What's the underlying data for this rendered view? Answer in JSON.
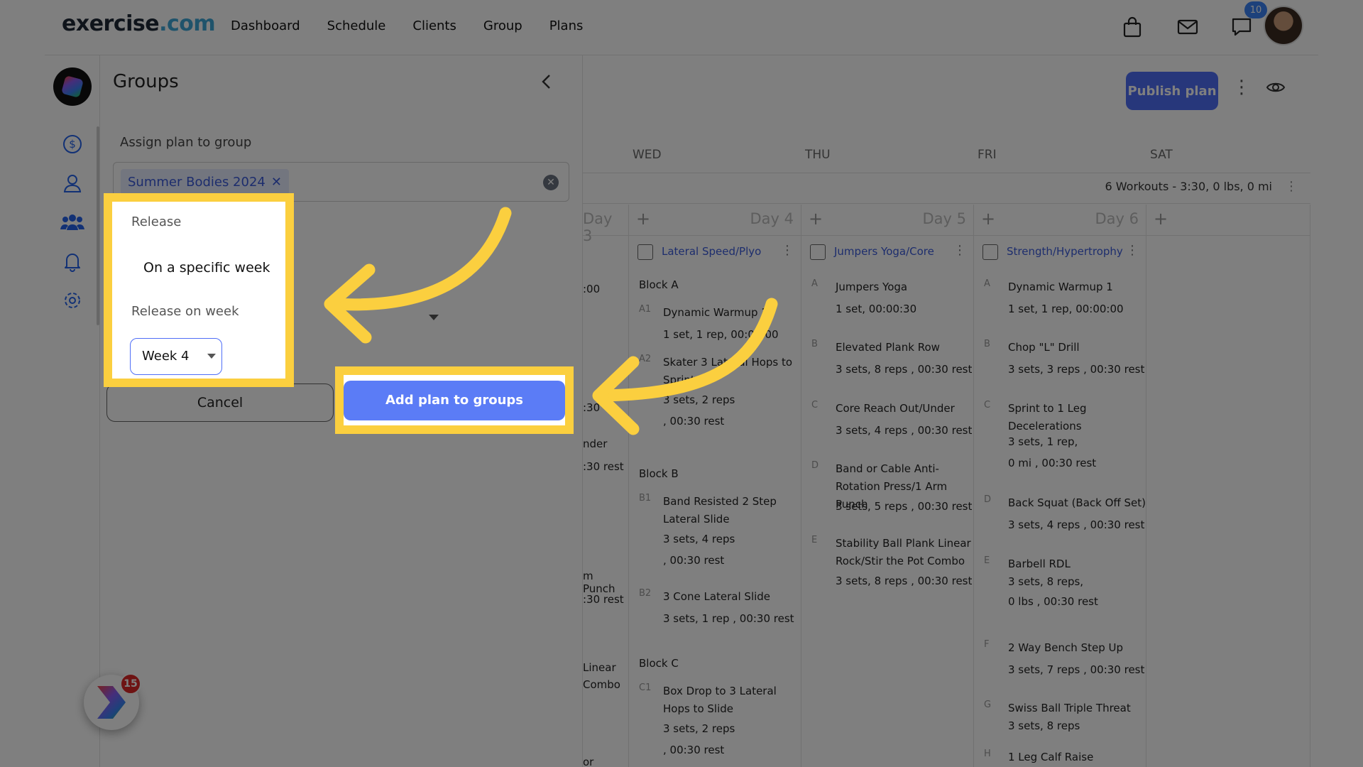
{
  "topbar": {
    "logo_main": "exercise",
    "logo_dom": ".com",
    "nav": [
      "Dashboard",
      "Schedule",
      "Clients",
      "Group",
      "Plans"
    ],
    "notification_count": "10"
  },
  "widget": {
    "badge": "15"
  },
  "panel": {
    "title": "Groups",
    "assign_label": "Assign plan to group",
    "chip_label": "Summer Bodies 2024",
    "release_label": "Release",
    "release_value": "On a specific week",
    "week_label": "Release on week",
    "week_value": "Week 4",
    "cancel_label": "Cancel",
    "add_label": "Add plan to groups"
  },
  "calendar": {
    "publish_label": "Publish plan",
    "day_headers": [
      "WED",
      "THU",
      "FRI",
      "SAT"
    ],
    "summary": "6 Workouts - 3:30, 0 lbs, 0 mi",
    "columns": [
      {
        "day": "Day 3",
        "title": "",
        "partial": true
      },
      {
        "day": "Day 4",
        "title": "Lateral Speed/Plyo"
      },
      {
        "day": "Day 5",
        "title": "Jumpers Yoga/Core"
      },
      {
        "day": "Day 6",
        "title": "Strength/Hypertrophy"
      },
      {
        "day": "",
        "title": ""
      }
    ],
    "partial_texts": [
      ":00",
      ":30",
      "nder",
      ":30 rest",
      "m Punch",
      ":30 rest",
      "Linear",
      "Combo",
      "or"
    ],
    "day4": {
      "blockA": "Block A",
      "a1_code": "A1",
      "a1_name": "Dynamic Warmup 1",
      "a1_d1": "1 set, 1 rep, 00:00:00",
      "a2_code": "A2",
      "a2_name": "Skater 3 Lateral Hops to Sprint",
      "a2_d1": "3 sets, 2 reps",
      "a2_d2": ", 00:30 rest",
      "blockB": "Block B",
      "b1_code": "B1",
      "b1_name": "Band Resisted 2 Step Lateral Slide",
      "b1_d1": "3 sets, 4 reps",
      "b1_d2": ", 00:30 rest",
      "b2_code": "B2",
      "b2_name": "3 Cone Lateral Slide",
      "b2_d1": "3 sets, 1 rep , 00:30 rest",
      "blockC": "Block C",
      "c1_code": "C1",
      "c1_name": "Box Drop to 3 Lateral Hops to Slide",
      "c1_d1": "3 sets, 2 reps",
      "c1_d2": ", 00:30 rest"
    },
    "day5": {
      "a_code": "A",
      "a_name": "Jumpers Yoga",
      "a_d1": "1 set, 00:00:30",
      "b_code": "B",
      "b_name": "Elevated Plank Row",
      "b_d1": "3 sets, 8 reps , 00:30 rest",
      "c_code": "C",
      "c_name": "Core Reach Out/Under",
      "c_d1": "3 sets, 4 reps , 00:30 rest",
      "d_code": "D",
      "d_name": "Band or Cable Anti-Rotation Press/1 Arm Punch",
      "d_d1": "3 sets, 5 reps , 00:30 rest",
      "e_code": "E",
      "e_name": "Stability Ball Plank Linear Rock/Stir the Pot Combo",
      "e_d1": "3 sets, 8 reps , 00:30 rest"
    },
    "day6": {
      "a_code": "A",
      "a_name": "Dynamic Warmup 1",
      "a_d1": "1 set, 1 rep, 00:00:00",
      "b_code": "B",
      "b_name": "Chop \"L\" Drill",
      "b_d1": "3 sets, 3 reps , 00:30 rest",
      "c_code": "C",
      "c_name": "Sprint to 1 Leg Decelerations",
      "c_d1": "3 sets, 1 rep,",
      "c_d2": "0 mi , 00:30 rest",
      "d_code": "D",
      "d_name": "Back Squat (Back Off Set)",
      "d_d1": "3 sets, 4 reps , 00:30 rest",
      "e_code": "E",
      "e_name": "Barbell RDL",
      "e_d1": "3 sets, 8 reps,",
      "e_d2": "0 lbs , 00:30 rest",
      "f_code": "F",
      "f_name": "2 Way Bench Step Up",
      "f_d1": "3 sets, 7 reps , 00:30 rest",
      "g_code": "G",
      "g_name": "Swiss Ball Triple Threat",
      "g_d1": "3 sets, 8 reps",
      "h_code": "H",
      "h_name": "1 Leg Calf Raise"
    }
  },
  "colors": {
    "accent": "#4f6ef7",
    "highlight": "#fbcf3f",
    "overlay": "rgba(0,0,0,0.5)"
  }
}
